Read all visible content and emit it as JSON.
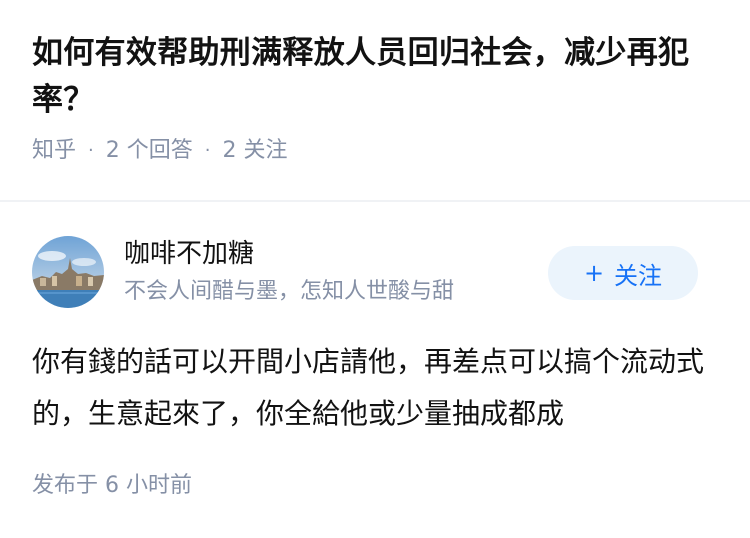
{
  "question": {
    "title": "如何有效帮助刑满释放人员回归社会，减少再犯率？",
    "source": "知乎",
    "separator": "·",
    "answer_count": "2 个回答",
    "follower_count": "2 关注"
  },
  "answer": {
    "author": {
      "name": "咖啡不加糖",
      "bio": "不会人间醋与墨，怎知人世酸与甜",
      "avatar_icon": "avatar-landscape-icon"
    },
    "follow_button": {
      "icon": "+",
      "label": "关注"
    },
    "content": "你有錢的話可以开間小店請他，再差点可以搞个流动式的，生意起來了，你全給他或少量抽成都成",
    "time": "发布于 6 小时前"
  },
  "colors": {
    "title": "#121212",
    "meta": "#8590a6",
    "accent": "#1772f6",
    "follow_bg": "#ebf4fc"
  }
}
